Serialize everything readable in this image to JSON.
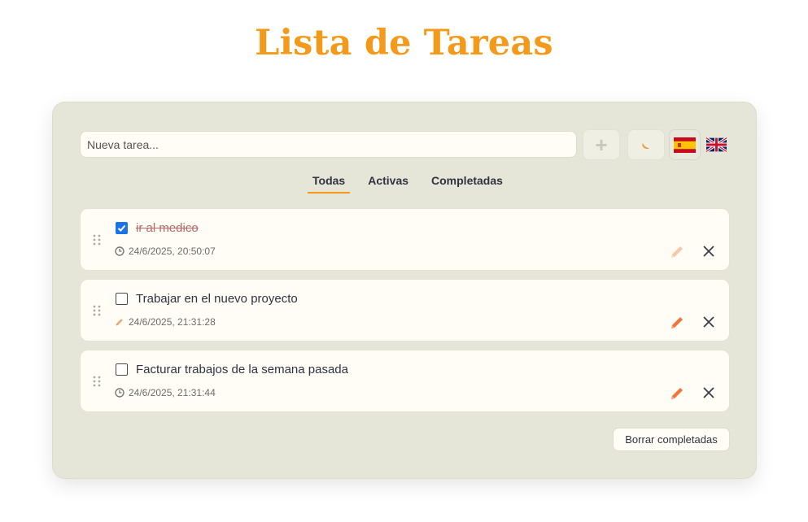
{
  "app": {
    "title": "Lista de Tareas"
  },
  "toolbar": {
    "input_placeholder": "Nueva tarea...",
    "input_value": "",
    "add_label": "+",
    "theme_icon": "moon-icon",
    "languages": [
      "es",
      "en"
    ],
    "selected_language": "es"
  },
  "tabs": [
    {
      "label": "Todas",
      "active": true
    },
    {
      "label": "Activas",
      "active": false
    },
    {
      "label": "Completadas",
      "active": false
    }
  ],
  "tasks": [
    {
      "text": "ir al medico",
      "completed": true,
      "timestamp": "24/6/2025, 20:50:07",
      "meta_icon": "clock-icon"
    },
    {
      "text": "Trabajar en el nuevo proyecto",
      "completed": false,
      "timestamp": "24/6/2025, 21:31:28",
      "meta_icon": "pencil-icon"
    },
    {
      "text": "Facturar trabajos de la semana pasada",
      "completed": false,
      "timestamp": "24/6/2025, 21:31:44",
      "meta_icon": "clock-icon"
    }
  ],
  "footer": {
    "clear_completed_label": "Borrar completadas"
  },
  "colors": {
    "accent": "#f39a1b",
    "card_bg": "#e6e6d8",
    "task_bg": "#fffdf6",
    "edit_active": "#f0753c",
    "edit_faded": "#f7c7a8"
  }
}
